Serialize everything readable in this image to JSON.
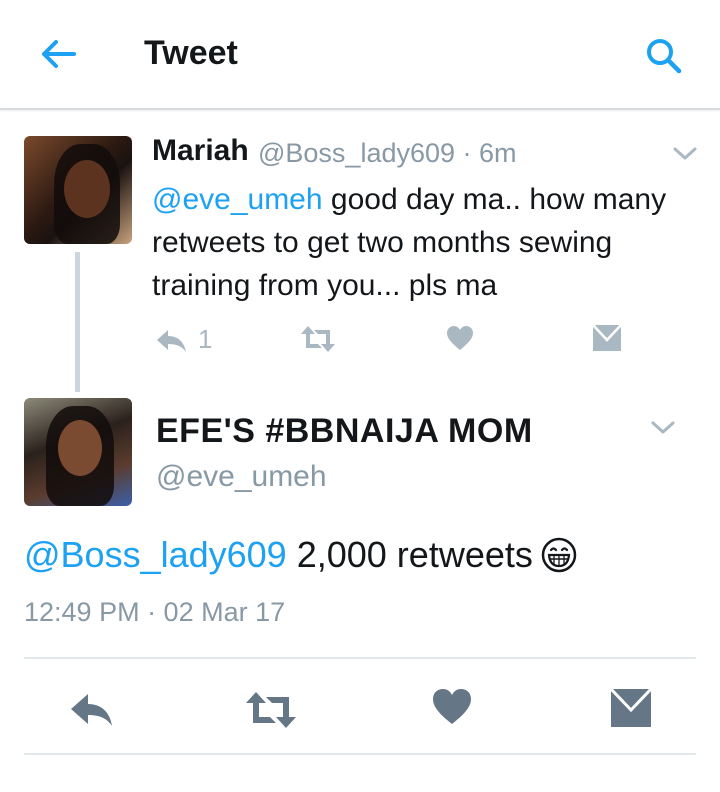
{
  "header": {
    "title": "Tweet",
    "back_icon": "back-arrow-icon",
    "search_icon": "search-icon"
  },
  "colors": {
    "accent": "#1da1f2",
    "muted": "#8899a6",
    "icon_gray": "#aab8c2",
    "icon_dark": "#657786"
  },
  "tweet_parent": {
    "name": "Mariah",
    "handle_time": "@Boss_lady609 · 6m",
    "mention": "@eve_umeh",
    "text": " good day ma.. how many retweets to get two months sewing training from you... pls ma",
    "reply_count": "1"
  },
  "tweet_main": {
    "name": "EFE'S #BBNAIJA MOM",
    "handle": "@eve_umeh",
    "mention": "@Boss_lady609",
    "text": " 2,000 retweets",
    "emoji": "grinning-face-icon",
    "timestamp": "12:49 PM · 02 Mar 17"
  }
}
